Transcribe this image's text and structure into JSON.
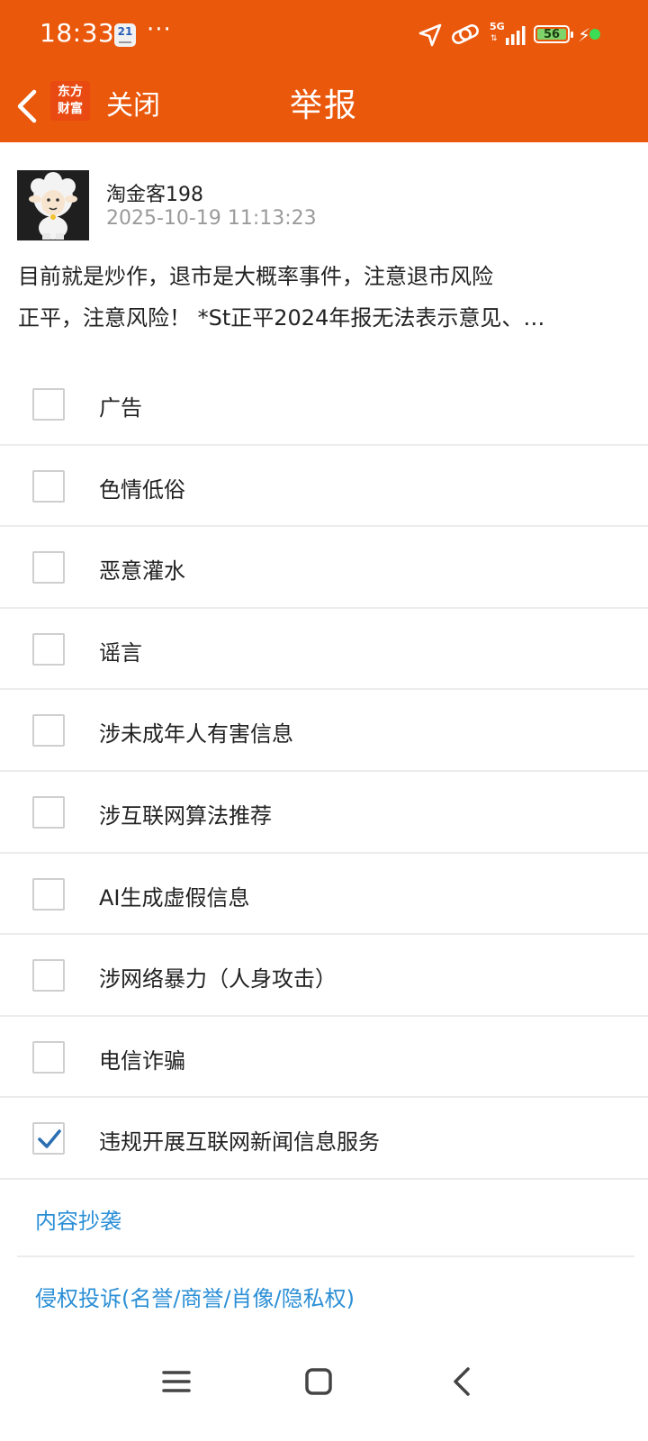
{
  "status_bar": {
    "time": "18:33",
    "calendar_day": "21",
    "more": "···",
    "network": "5G",
    "battery": "56",
    "accent_color": "#ea580c"
  },
  "header": {
    "logo_line1": "东方",
    "logo_line2": "财富",
    "close_label": "关闭",
    "title": "举报"
  },
  "post": {
    "username": "淘金客198",
    "timestamp": "2025-10-19 11:13:23",
    "text_lines": [
      "目前就是炒作，退市是大概率事件，注意退市风险",
      "正平，注意风险！ *St正平2024年报无法表示意见、…"
    ]
  },
  "options": [
    {
      "label": "广告",
      "checked": false
    },
    {
      "label": "色情低俗",
      "checked": false
    },
    {
      "label": "恶意灌水",
      "checked": false
    },
    {
      "label": "谣言",
      "checked": false
    },
    {
      "label": "涉未成年人有害信息",
      "checked": false
    },
    {
      "label": "涉互联网算法推荐",
      "checked": false
    },
    {
      "label": "AI生成虚假信息",
      "checked": false
    },
    {
      "label": "涉网络暴力（人身攻击）",
      "checked": false
    },
    {
      "label": "电信诈骗",
      "checked": false
    },
    {
      "label": "违规开展互联网新闻信息服务",
      "checked": true
    }
  ],
  "links": {
    "plagiarism": "内容抄袭",
    "infringement": "侵权投诉(名誉/商誉/肖像/隐私权)"
  },
  "icons": {
    "back": "chevron-left-icon",
    "checkbox_checked": "check-icon",
    "nav_menu": "menu-icon",
    "nav_home": "square-home-icon",
    "nav_back": "chevron-left-icon"
  }
}
